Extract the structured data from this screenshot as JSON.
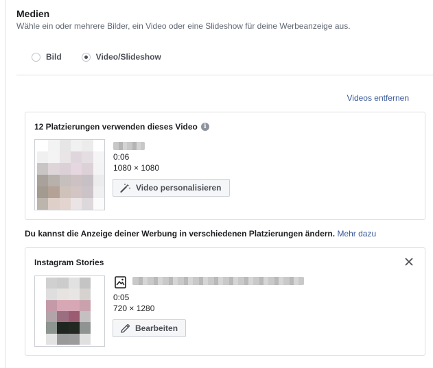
{
  "header": {
    "title": "Medien",
    "subtitle": "Wähle ein oder mehrere Bilder, ein Video oder eine Slideshow für deine Werbeanzeige aus."
  },
  "media_type": {
    "options": [
      {
        "label": "Bild",
        "selected": false
      },
      {
        "label": "Video/Slideshow",
        "selected": true
      }
    ]
  },
  "remove_videos_label": "Videos entfernen",
  "main_video": {
    "title": "12 Platzierungen verwenden dieses Video",
    "info_icon": "info-icon",
    "duration": "0:06",
    "resolution": "1080 × 1080",
    "personalize_label": "Video personalisieren",
    "personalize_icon": "magic-wand-icon"
  },
  "placement_note": {
    "text": "Du kannst die Anzeige deiner Werbung in verschiedenen Platzierungen ändern.",
    "link": "Mehr dazu"
  },
  "stories": {
    "title": "Instagram Stories",
    "media_icon": "image-video-icon",
    "duration": "0:05",
    "resolution": "720 × 1280",
    "edit_label": "Bearbeiten",
    "edit_icon": "pencil-icon",
    "close_icon": "close-icon"
  },
  "colors": {
    "link": "#385898",
    "border": "#dddfe2",
    "button_bg": "#f5f6f7"
  }
}
